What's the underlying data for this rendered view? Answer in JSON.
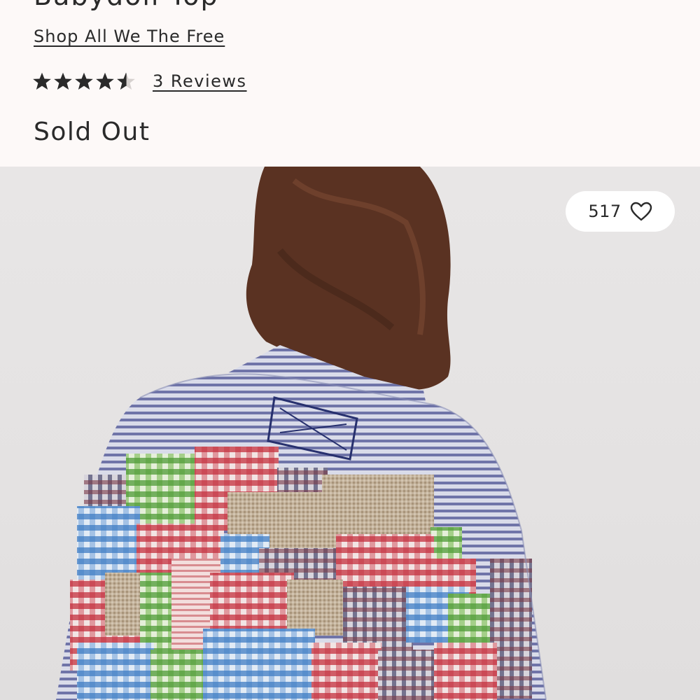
{
  "product": {
    "title": "Babydoll Top",
    "brand_link": "Shop All We The Free",
    "rating": {
      "value": 4.5,
      "max": 5,
      "reviews_link": "3 Reviews"
    },
    "stock_status": "Sold Out"
  },
  "favorite": {
    "count": "517",
    "icon": "heart-outline-icon"
  },
  "colors": {
    "text": "#2a2a2a",
    "background": "#fdf9f8",
    "star": "#2a2a2a"
  }
}
